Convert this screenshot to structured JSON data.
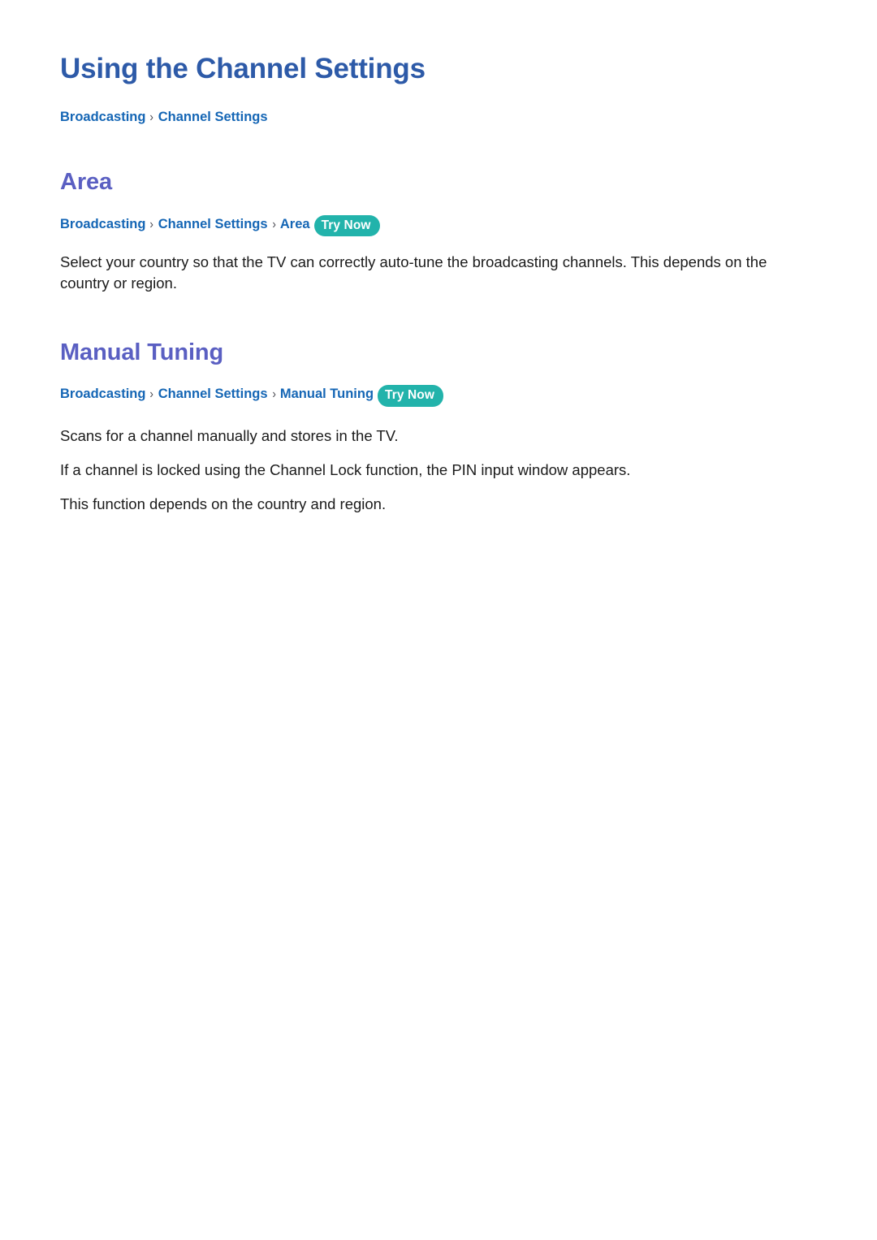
{
  "document": {
    "title": "Using the Channel Settings",
    "top_breadcrumb": {
      "crumb1": "Broadcasting",
      "separator": "›",
      "crumb2": "Channel Settings"
    }
  },
  "colors": {
    "page_title": "#2d5aa8",
    "section_heading": "#5a5fc2",
    "breadcrumb_link": "#1566b5",
    "breadcrumb_separator": "#4a4a52",
    "try_now_badge_bg": "#22b3ab",
    "try_now_badge_text": "#ffffff",
    "body_text": "#1b1b1b",
    "page_background": "#ffffff"
  },
  "sections": [
    {
      "id": "area",
      "heading": "Area",
      "breadcrumb": {
        "crumb1": "Broadcasting",
        "separator1": "›",
        "crumb2": "Channel Settings",
        "separator2": "›",
        "crumb3": "Area",
        "badge": "Try Now"
      },
      "paragraphs": [
        "Select your country so that the TV can correctly auto-tune the broadcasting channels. This depends on the country or region."
      ]
    },
    {
      "id": "manual-tuning",
      "heading": "Manual Tuning",
      "breadcrumb": {
        "crumb1": "Broadcasting",
        "separator1": "›",
        "crumb2": "Channel Settings",
        "separator2": "›",
        "crumb3": "Manual Tuning",
        "badge": "Try Now"
      },
      "paragraphs": [
        "Scans for a channel manually and stores in the TV.",
        "If a channel is locked using the Channel Lock function, the PIN input window appears.",
        "This function depends on the country and region."
      ]
    }
  ]
}
